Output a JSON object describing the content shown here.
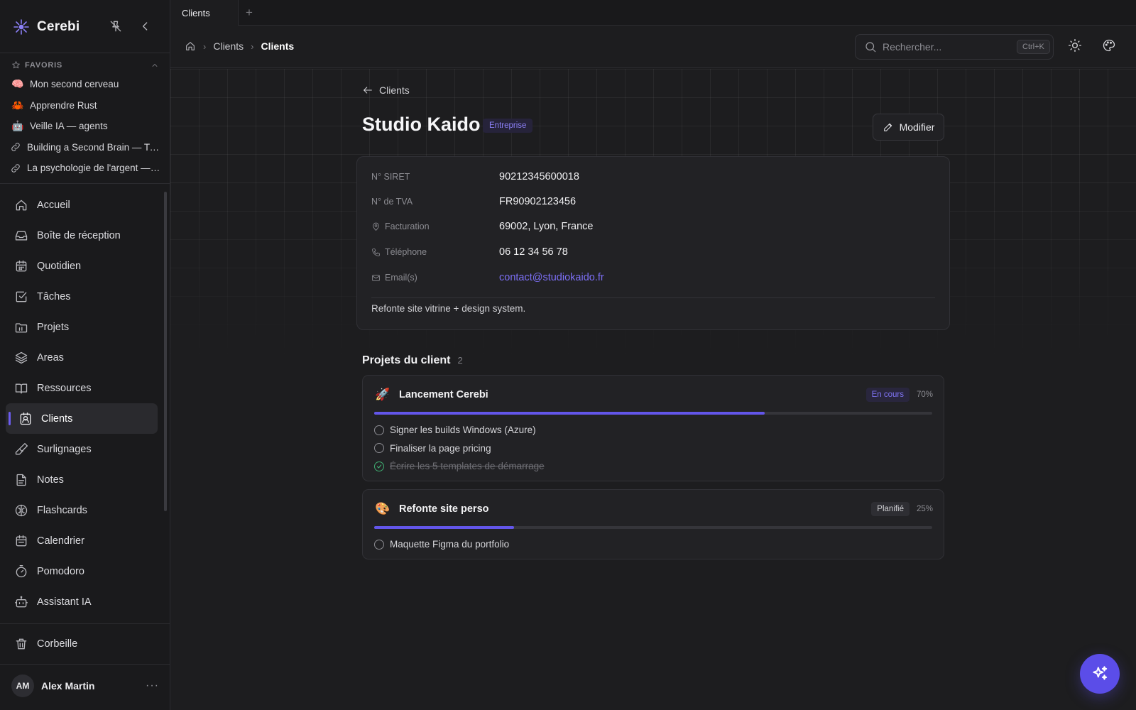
{
  "app": {
    "name": "Cerebi"
  },
  "tabs": [
    {
      "label": "Clients"
    }
  ],
  "favorites": {
    "heading": "FAVORIS",
    "items": [
      {
        "emoji": "🧠",
        "label": "Mon second cerveau"
      },
      {
        "emoji": "🦀",
        "label": "Apprendre Rust"
      },
      {
        "emoji": "🤖",
        "label": "Veille IA — agents"
      },
      {
        "icon": "link-icon",
        "label": "Building a Second Brain — Tia..."
      },
      {
        "icon": "link-icon",
        "label": "La psychologie de l'argent — ..."
      }
    ]
  },
  "nav": [
    {
      "icon": "home-icon",
      "label": "Accueil"
    },
    {
      "icon": "inbox-icon",
      "label": "Boîte de réception"
    },
    {
      "icon": "calendar-day-icon",
      "label": "Quotidien"
    },
    {
      "icon": "checkbox-icon",
      "label": "Tâches"
    },
    {
      "icon": "folder-icon",
      "label": "Projets"
    },
    {
      "icon": "layers-icon",
      "label": "Areas"
    },
    {
      "icon": "book-icon",
      "label": "Ressources"
    },
    {
      "icon": "contact-icon",
      "label": "Clients",
      "active": true
    },
    {
      "icon": "highlighter-icon",
      "label": "Surlignages"
    },
    {
      "icon": "note-icon",
      "label": "Notes"
    },
    {
      "icon": "brain-icon",
      "label": "Flashcards"
    },
    {
      "icon": "calendar-icon",
      "label": "Calendrier"
    },
    {
      "icon": "timer-icon",
      "label": "Pomodoro"
    },
    {
      "icon": "bot-icon",
      "label": "Assistant IA"
    }
  ],
  "trash": {
    "label": "Corbeille"
  },
  "user": {
    "initials": "AM",
    "name": "Alex Martin"
  },
  "breadcrumb": {
    "items": [
      "Clients",
      "Clients"
    ]
  },
  "search": {
    "placeholder": "Rechercher...",
    "shortcut": "Ctrl+K"
  },
  "client": {
    "back_label": "Clients",
    "name": "Studio Kaido",
    "type_badge": "Entreprise",
    "edit_label": "Modifier",
    "fields": [
      {
        "label": "N° SIRET",
        "value": "90212345600018"
      },
      {
        "label": "N° de TVA",
        "value": "FR90902123456"
      },
      {
        "icon": "map-pin-icon",
        "label": "Facturation",
        "value": "69002, Lyon, France"
      },
      {
        "icon": "phone-icon",
        "label": "Téléphone",
        "value": "06 12 34 56 78"
      },
      {
        "icon": "mail-icon",
        "label": "Email(s)",
        "value": "contact@studiokaido.fr"
      }
    ],
    "note": "Refonte site vitrine + design system."
  },
  "projects": {
    "heading": "Projets du client",
    "count": "2",
    "items": [
      {
        "emoji": "🚀",
        "name": "Lancement Cerebi",
        "status": "En cours",
        "progress_label": "70%",
        "progress": 0.7,
        "tasks": [
          {
            "label": "Signer les builds Windows (Azure)",
            "done": false
          },
          {
            "label": "Finaliser la page pricing",
            "done": false
          },
          {
            "label": "Écrire les 5 templates de démarrage",
            "done": true
          }
        ]
      },
      {
        "emoji": "🎨",
        "name": "Refonte site perso",
        "status": "Planifié",
        "progress_label": "25%",
        "progress": 0.25,
        "tasks": [
          {
            "label": "Maquette Figma du portfolio",
            "done": false
          }
        ]
      }
    ]
  },
  "colors": {
    "accent": "#6356ea",
    "link": "#7c6ff5",
    "done": "#3fae72"
  }
}
